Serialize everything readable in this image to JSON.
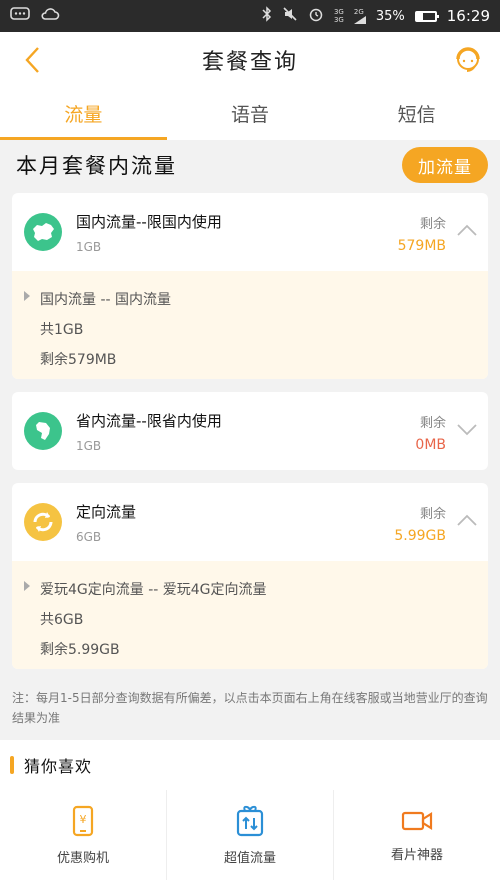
{
  "status_bar": {
    "time": "16:29",
    "battery": "35%",
    "battery_fraction": 0.35,
    "network_top": "3G",
    "network_sub1": "3G",
    "network_sub2": "2G"
  },
  "nav": {
    "title": "套餐查询"
  },
  "tabs": [
    {
      "label": "流量",
      "active": true
    },
    {
      "label": "语音",
      "active": false
    },
    {
      "label": "短信",
      "active": false
    }
  ],
  "section": {
    "title": "本月套餐内流量",
    "add_label": "加流量"
  },
  "cards": [
    {
      "name": "国内流量--限国内使用",
      "total": "1GB",
      "remain_label": "剩余",
      "remain_value": "579MB",
      "remain_color": "#f5a623",
      "icon": "china-map-icon",
      "icon_color": "#3cc48c",
      "expanded": true,
      "detail": {
        "title": "国内流量 -- 国内流量",
        "total": "共1GB",
        "remain": "剩余579MB"
      }
    },
    {
      "name": "省内流量--限省内使用",
      "total": "1GB",
      "remain_label": "剩余",
      "remain_value": "0MB",
      "remain_color": "#e8664a",
      "icon": "province-map-icon",
      "icon_color": "#3cc48c",
      "expanded": false
    },
    {
      "name": "定向流量",
      "total": "6GB",
      "remain_label": "剩余",
      "remain_value": "5.99GB",
      "remain_color": "#f5a623",
      "icon": "refresh-icon",
      "icon_color": "#f5c342",
      "expanded": true,
      "detail": {
        "title": "爱玩4G定向流量 -- 爱玩4G定向流量",
        "total": "共6GB",
        "remain": "剩余5.99GB"
      }
    }
  ],
  "note": "注：每月1-5日部分查询数据有所偏差，以点击本页面右上角在线客服或当地营业厅的查询结果为准",
  "guess": {
    "title": "猜你喜欢",
    "items": [
      {
        "label": "优惠购机",
        "icon": "phone-yuan-icon"
      },
      {
        "label": "超值流量",
        "icon": "gift-transfer-icon"
      },
      {
        "label": "看片神器",
        "icon": "video-camera-icon"
      }
    ]
  },
  "colors": {
    "accent": "#f5a623",
    "accent_blue": "#2b8fd6",
    "green": "#3cc48c"
  }
}
